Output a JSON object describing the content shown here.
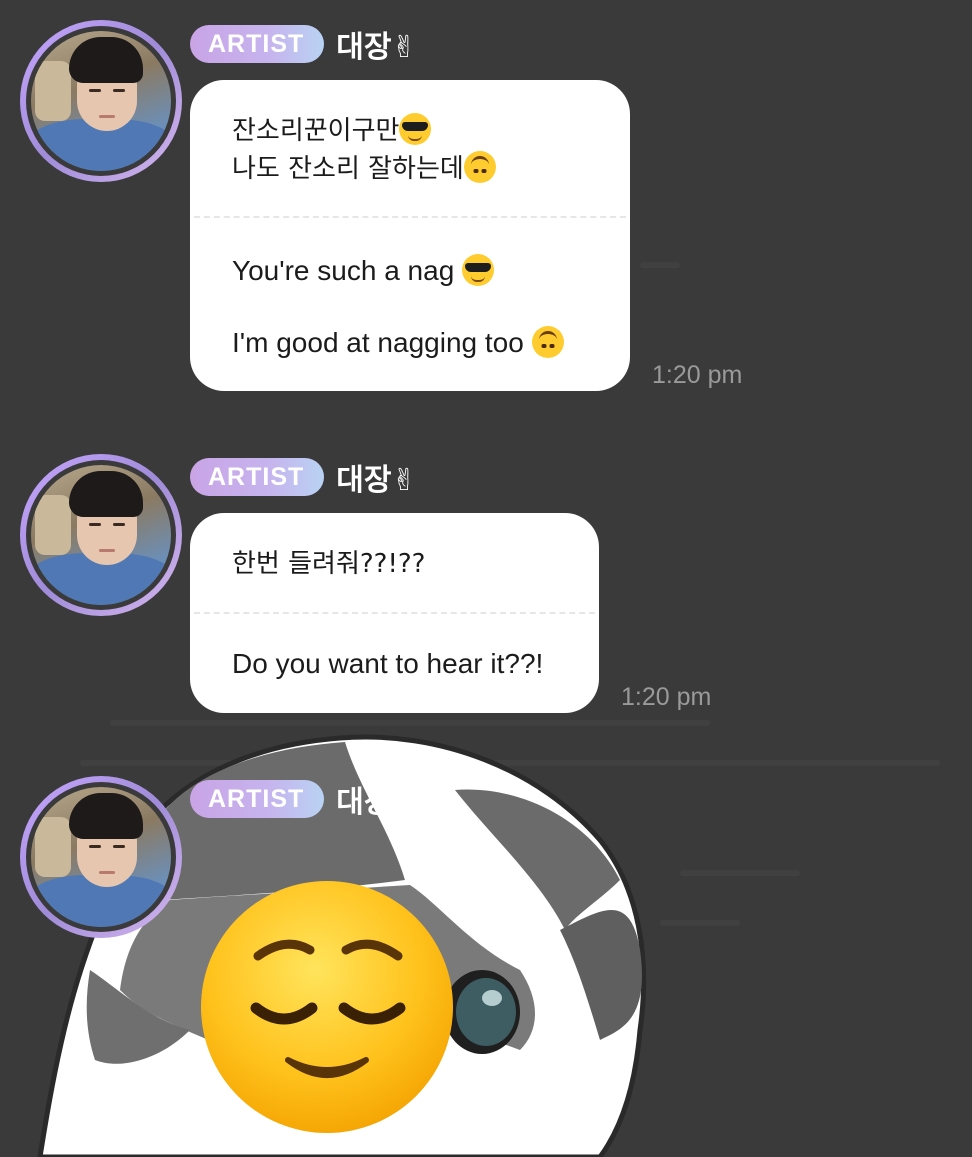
{
  "messages": [
    {
      "badge": "ARTIST",
      "sender": "대장",
      "sender_emoji": "✌",
      "korean_lines": [
        "잔소리꾼이구만",
        "나도 잔소리 잘하는데"
      ],
      "english_lines": [
        "You're such a nag",
        "I'm good at nagging too"
      ],
      "time": "1:20 pm"
    },
    {
      "badge": "ARTIST",
      "sender": "대장",
      "sender_emoji": "✌",
      "korean_lines": [
        "한번 들려줘??!??"
      ],
      "english_lines": [
        "Do you want to hear it??!"
      ],
      "time": "1:20 pm"
    },
    {
      "badge": "ARTIST",
      "sender": "대장",
      "sender_emoji": "✌",
      "sticker": "cat-with-relieved-face-sticker"
    }
  ],
  "icons": {
    "sunglasses": "smiling-face-with-sunglasses-icon",
    "upside_down": "upside-down-face-icon",
    "relieved": "relieved-face-icon"
  },
  "colors": {
    "background": "#3a3a3b",
    "bubble": "#ffffff",
    "badge_start": "#c9a4e6",
    "badge_end": "#b9d3f3",
    "timestamp": "#9a9a9a"
  }
}
